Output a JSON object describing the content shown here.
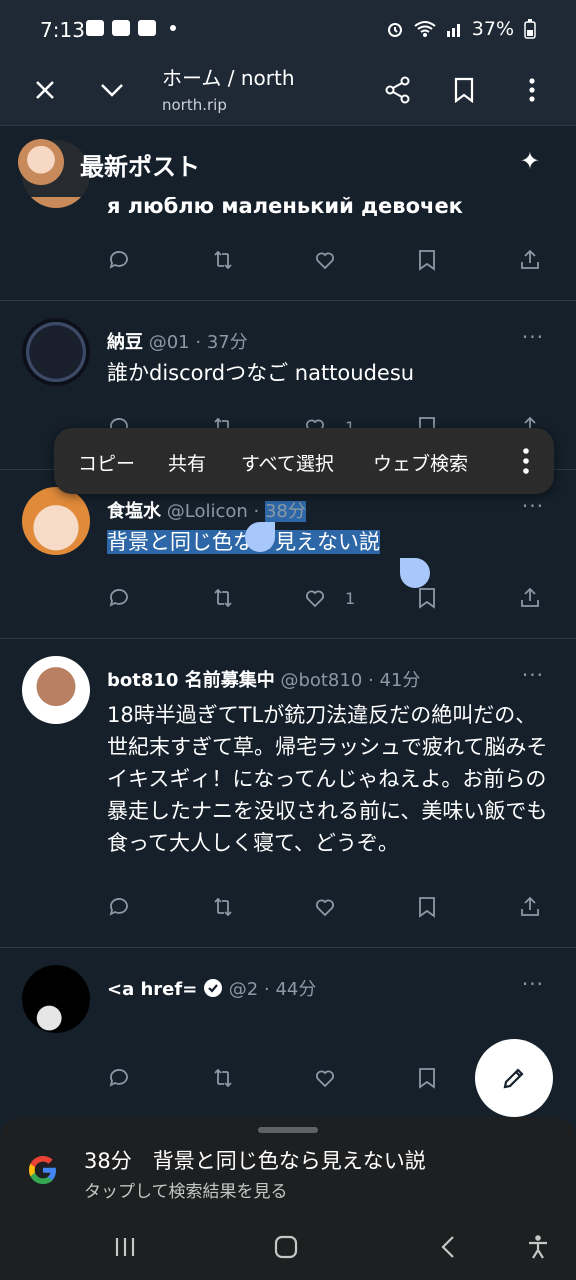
{
  "status_bar": {
    "time": "7:13",
    "battery": "37%"
  },
  "browser": {
    "title": "ホーム / north",
    "url": "north.rip"
  },
  "feed_header": {
    "title": "最新ポスト"
  },
  "posts": [
    {
      "text": "я люблю маленький девочек"
    },
    {
      "name": "納豆",
      "handle": "@01",
      "sep": "·",
      "time": "37分",
      "text": "誰かdiscordつなご nattoudesu",
      "likes": "1"
    },
    {
      "name": "食塩水",
      "handle": "@Lolicon",
      "sep": "·",
      "time": "38分",
      "text": "背景と同じ色なら見えない説",
      "likes": "1"
    },
    {
      "name": "bot810 名前募集中",
      "handle": "@bot810",
      "sep": "·",
      "time": "41分",
      "text": "18時半過ぎてTLが銃刀法違反だの絶叫だの、世紀末すぎて草。帰宅ラッシュで疲れて脳みそイキスギィ！になってんじゃねえよ。お前らの暴走したナニを没収される前に、美味い飯でも食って大人しく寝て、どうぞ。"
    },
    {
      "name": "<a href=",
      "handle": "@2",
      "sep": "·",
      "time": "44分"
    }
  ],
  "context_menu": {
    "copy": "コピー",
    "share": "共有",
    "select_all": "すべて選択",
    "web_search": "ウェブ検索"
  },
  "google_sheet": {
    "title": "38分　背景と同じ色なら見えない説",
    "subtitle": "タップして検索結果を見る"
  },
  "colors": {
    "background": "#15202b",
    "selection": "#2e67a8",
    "handle": "#a8c7fa",
    "muted": "#8b98a5"
  }
}
